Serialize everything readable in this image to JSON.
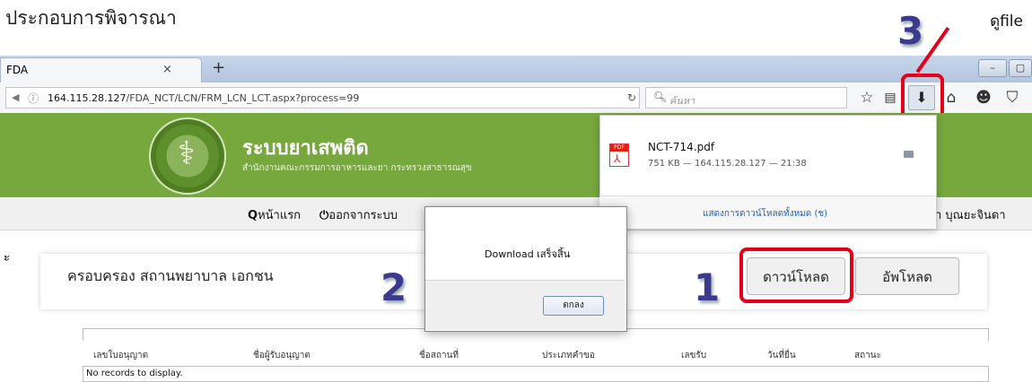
{
  "annotation": {
    "heading": "ประกอบการพิจารณา",
    "view_file_label": "ดูfile",
    "step1": "1",
    "step2": "2",
    "step3": "3"
  },
  "browser": {
    "tab_title": "FDA",
    "tab_close": "×",
    "new_tab": "+",
    "url_host": "164.115.28.127",
    "url_path": "/FDA_NCT/LCN/FRM_LCN_LCT.aspx?process=99",
    "search_placeholder": "ค้นหา",
    "icons": [
      "star-icon",
      "reading-list-icon",
      "download-icon",
      "home-icon",
      "smiley-icon",
      "pocket-icon"
    ],
    "window_controls": [
      "–",
      "▢"
    ]
  },
  "site": {
    "brand_title": "ระบบยาเสพติด",
    "brand_subtitle": "สำนักงานคณะกรรมการอาหารและยา กระทรวงสาธารณสุข",
    "menu": [
      "หน้าแรก",
      "ออกจากระบบ"
    ],
    "user_name": "า บุณยะจินดา",
    "side_mark": "ะ"
  },
  "card": {
    "title": "ครอบครอง สถานพยาบาล เอกชน",
    "download_button": "ดาวน์โหลด",
    "upload_button": "อัพโหลด"
  },
  "grid": {
    "columns": [
      "เลขใบอนุญาต",
      "ชื่อผู้รับอนุญาต",
      "ชื่อสถานที่",
      "ประเภทคำขอ",
      "เลขรับ",
      "วันที่ยื่น",
      "สถานะ"
    ],
    "empty_text": "No records to display."
  },
  "download_panel": {
    "file_name": "NCT-714.pdf",
    "file_meta": "751 KB — 164.115.28.127 — 21:38",
    "show_all": "แสดงการดาวน์โหลดทั้งหมด (ช)",
    "pdf_badge": "PDF"
  },
  "dialog": {
    "message": "Download เสร็จสิ้น",
    "ok_button": "ตกลง"
  },
  "colors": {
    "banner_green": "#76a83e",
    "highlight_red": "#e3001b",
    "step_number": "#3b3a8f"
  }
}
